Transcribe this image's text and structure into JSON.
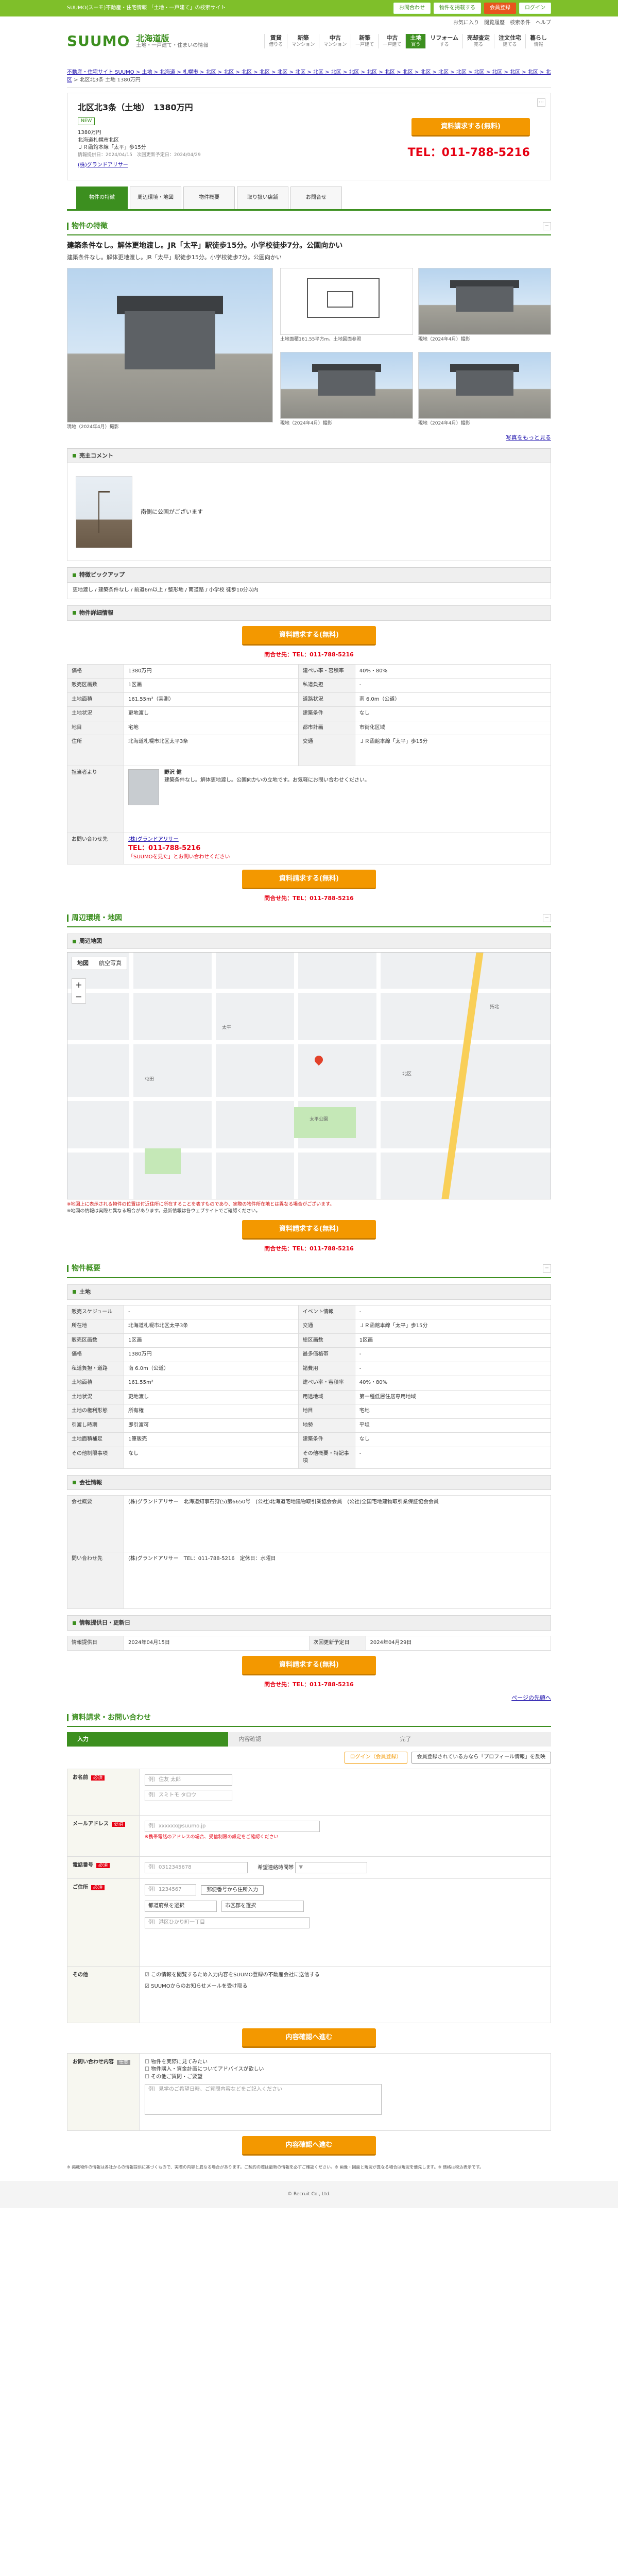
{
  "top": {
    "tagline": "SUUMO(スーモ)不動産・住宅情報 「土地・一戸建て」の検索サイト",
    "links": [
      "お問合わせ",
      "物件を掲載する",
      "会員登録",
      "ログイン"
    ]
  },
  "header": {
    "logo": "SUUMO",
    "region": "北海道版",
    "region_sub": "土地・一戸建て・住まいの情報",
    "util": [
      "お気に入り",
      "閲覧履歴",
      "検索条件",
      "ヘルプ"
    ],
    "nav": [
      {
        "label": "賃貸",
        "sub": "借りる"
      },
      {
        "label": "新築",
        "sub": "マンション"
      },
      {
        "label": "中古",
        "sub": "マンション"
      },
      {
        "label": "新築",
        "sub": "一戸建て"
      },
      {
        "label": "中古",
        "sub": "一戸建て"
      },
      {
        "label": "土地",
        "sub": "買う"
      },
      {
        "label": "リフォーム",
        "sub": "する"
      },
      {
        "label": "売却査定",
        "sub": "売る"
      },
      {
        "label": "注文住宅",
        "sub": "建てる"
      },
      {
        "label": "暮らし",
        "sub": "情報"
      }
    ]
  },
  "breadcrumb": "不動産・住宅サイト SUUMO > 土地 > 北海道 > 札幌市 > 北区 > 北区 > 北区 > 北区 > 北区 > 北区 > 北区 > 北区 > 北区 > 北区 > 北区 > 北区 > 北区 > 北区 > 北区 > 北区 > 北区 > 北区 > 北区 > 北区",
  "breadcrumb_current": "北区北3条 土地 1380万円",
  "title": {
    "name": "北区北3条（土地）　1380万円",
    "tag": "NEW",
    "price": "1380万円",
    "address": "北海道札幌市北区",
    "access": "ＪＲ函館本線「太平」歩15分",
    "note": "情報提供日：2024/04/15　次回更新予定日：2024/04/29",
    "agent": "(株)グランドアリサー",
    "cta": "資料請求する(無料)",
    "tel": "TEL：011-788-5216"
  },
  "tabs": [
    "物件の特徴",
    "周辺環境・地図",
    "物件概要",
    "取り扱い店舗",
    "お問合せ"
  ],
  "feature": {
    "section": "物件の特徴",
    "headline": "建築条件なし。解体更地渡し。JR「太平」駅徒歩15分。小学校徒歩7分。公園向かい",
    "body": "建築条件なし。解体更地渡し。JR「太平」駅徒歩15分。小学校徒歩7分。公園向かい",
    "captions": [
      "土地面積161.55平方m、土地図面参照",
      "現地（2024年4月）撮影",
      "現地（2024年4月）撮影",
      "現地（2024年4月）撮影",
      "現地（2024年4月）撮影"
    ],
    "more": "写真をもっと見る"
  },
  "comment": {
    "section": "売主コメント",
    "text": "南側に公園がございます"
  },
  "pickup": {
    "section": "特徴ピックアップ",
    "text": "更地渡し / 建築条件なし / 前道6m以上 / 整形地 / 南道路 / 小学校 徒歩10分以内"
  },
  "detail": {
    "section": "物件詳細情報",
    "cta": "資料請求する(無料)",
    "tel": "問合せ先：TEL：011-788-5216",
    "rows": [
      {
        "k": "価格",
        "v": "1380万円",
        "k2": "建ぺい率・容積率",
        "v2": "40%・80%"
      },
      {
        "k": "販売区画数",
        "v": "1区画",
        "k2": "私道負担",
        "v2": "-"
      },
      {
        "k": "土地面積",
        "v": "161.55m²（実測）",
        "k2": "道路状況",
        "v2": "南 6.0m（公道）"
      },
      {
        "k": "土地状況",
        "v": "更地渡し",
        "k2": "建築条件",
        "v2": "なし"
      },
      {
        "k": "地目",
        "v": "宅地",
        "k2": "都市計画",
        "v2": "市街化区域"
      }
    ],
    "address_label": "住所",
    "address": "北海道札幌市北区太平3条",
    "traffic_label": "交通",
    "traffic": "ＪＲ函館本線「太平」歩15分",
    "staff_label": "担当者より",
    "staff_name": "野沢 健",
    "staff_text": "建築条件なし。解体更地渡し。公園向かいの立地です。お気軽にお問い合わせください。",
    "contact_label": "お問い合わせ先",
    "company": "(株)グランドアリサー",
    "contact_tel": "TEL：011-788-5216",
    "contact_note": "「SUUMOを見た」とお問い合わせください"
  },
  "env": {
    "section": "周辺環境・地図",
    "sub": "周辺地図",
    "map_tabs": [
      "地図",
      "航空写真"
    ],
    "labels": [
      "太平",
      "北区",
      "屯田",
      "太平公園",
      "拓北"
    ],
    "note1": "※地図上に表示される物件の位置は付近住所に所在することを表すものであり、実際の物件所在地とは異なる場合がございます。",
    "note2": "※地図の情報は実際と異なる場合があります。最新情報は各ウェブサイトでご確認ください。",
    "cta": "資料請求する(無料)",
    "tel": "問合せ先：TEL：011-788-5216"
  },
  "summary": {
    "section": "物件概要",
    "sub1": "土地",
    "rows": [
      {
        "k": "販売スケジュール",
        "v": "-",
        "k2": "イベント情報",
        "v2": "-"
      },
      {
        "k": "所在地",
        "v": "北海道札幌市北区太平3条",
        "k2": "交通",
        "v2": "ＪＲ函館本線「太平」歩15分"
      },
      {
        "k": "販売区画数",
        "v": "1区画",
        "k2": "総区画数",
        "v2": "1区画"
      },
      {
        "k": "価格",
        "v": "1380万円",
        "k2": "最多価格帯",
        "v2": "-"
      },
      {
        "k": "私道負担・道路",
        "v": "南 6.0m（公道）",
        "k2": "諸費用",
        "v2": "-"
      },
      {
        "k": "土地面積",
        "v": "161.55m²",
        "k2": "建ぺい率・容積率",
        "v2": "40%・80%"
      },
      {
        "k": "土地状況",
        "v": "更地渡し",
        "k2": "用途地域",
        "v2": "第一種低層住居専用地域"
      },
      {
        "k": "土地の権利形態",
        "v": "所有権",
        "k2": "地目",
        "v2": "宅地"
      },
      {
        "k": "引渡し時期",
        "v": "即引渡可",
        "k2": "地勢",
        "v2": "平坦"
      },
      {
        "k": "土地面積補足",
        "v": "1筆販売",
        "k2": "建築条件",
        "v2": "なし"
      },
      {
        "k": "その他制限事項",
        "v": "なし",
        "k2": "その他概要・特記事項",
        "v2": "-"
      }
    ],
    "sub2": "会社情報",
    "company_rows": [
      {
        "k": "会社概要",
        "v": "(株)グランドアリサー　北海道知事石狩(5)第6650号　(公社)北海道宅地建物取引業協会会員　(公社)全国宅地建物取引業保証協会会員"
      },
      {
        "k": "問い合わせ先",
        "v": "(株)グランドアリサー　TEL：011-788-5216　定休日：水曜日"
      }
    ],
    "sub3": "情報提供日・更新日",
    "date_rows": [
      {
        "k": "情報提供日",
        "v": "2024年04月15日",
        "k2": "次回更新予定日",
        "v2": "2024年04月29日"
      }
    ],
    "cta": "資料請求する(無料)",
    "tel": "問合せ先：TEL：011-788-5216",
    "pagetop": "ページの先頭へ"
  },
  "form": {
    "section": "資料請求・お問い合わせ",
    "steps": [
      "入力",
      "内容確認",
      "完了"
    ],
    "login_btn": "ログイン（会員登録）",
    "profile_btn": "会員登録されている方なら「プロフィール情報」を反映",
    "name_label": "お名前",
    "name_ph": "例）住友 太郎",
    "kana_ph": "例）スミトモ タロウ",
    "mail_label": "メールアドレス",
    "mail_ph": "例）xxxxxx@suumo.jp",
    "mail_note": "※携帯電話のアドレスの場合、受信制限の設定をご確認ください",
    "tel_label": "電話番号",
    "tel_ph": "例）0312345678",
    "contact_time_label": "希望連絡時間帯",
    "address_label": "ご住所",
    "zip_ph": "例）1234567",
    "zip_btn": "郵便番号から住所入力",
    "pref": "都道府県を選択",
    "city": "市区郡を選択",
    "street_ph": "例）港区ひかり町一丁目",
    "other_label": "その他",
    "check1": "この情報を閲覧するため入力内容をSUUMO登録の不動産会社に送信する",
    "check2": "SUUMOからのお知らせメールを受け取る",
    "confirm_btn": "内容確認へ進む",
    "inquiry_label": "お問い合わせ内容",
    "inquiry_opts": [
      "物件を実際に見てみたい",
      "物件購入・資金計画についてアドバイスが欲しい",
      "その他ご質問・ご要望"
    ],
    "free_ph": "例）見学のご希望日時、ご質問内容などをご記入ください",
    "confirm_btn2": "内容確認へ進む"
  },
  "footnotes": "※ 掲載物件の情報は各社からの情報提供に基づくもので、実際の内容と異なる場合があります。ご契約の際は最新の情報を必ずご確認ください。※ 画像・図面と現況が異なる場合は現況を優先します。※ 価格は税込表示です。",
  "footer": "© Recruit Co., Ltd."
}
